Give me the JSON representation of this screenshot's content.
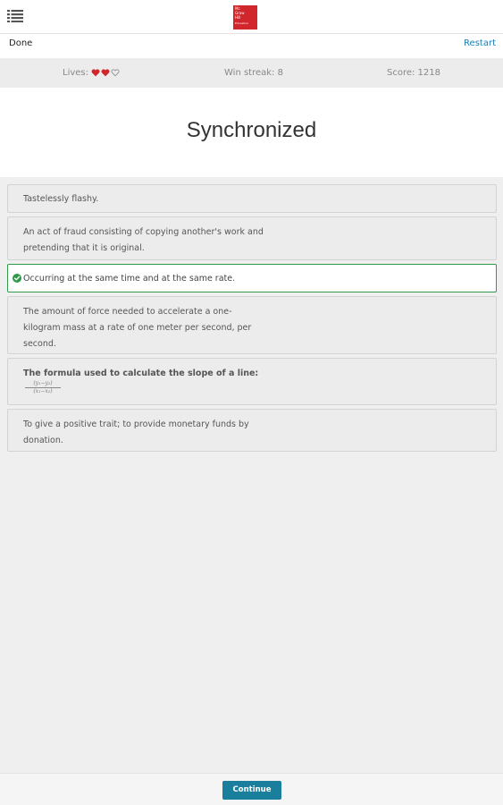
{
  "header": {
    "menu_icon": "hamburger-list-icon",
    "logo_lines": [
      "Mc",
      "Graw",
      "Hill",
      "Education"
    ]
  },
  "actionbar": {
    "done_label": "Done",
    "restart_label": "Restart"
  },
  "status": {
    "lives_label": "Lives:",
    "lives_total": 3,
    "lives_remaining": 2,
    "win_streak": "Win streak: 8",
    "score": "Score: 1218"
  },
  "question": {
    "term": "Synchronized"
  },
  "answers": [
    {
      "text": "Tastelessly flashy.",
      "state": "default"
    },
    {
      "text": "An act of fraud consisting of copying another's work and pretending that it is original.",
      "state": "default"
    },
    {
      "text": "Occurring at the same time and at the same rate.",
      "state": "correct",
      "icon": "check-circle-icon"
    },
    {
      "text": "The amount of force needed to accelerate a one-kilogram mass at a rate of one meter per second, per second.",
      "state": "default"
    },
    {
      "text": "The formula used to calculate the slope of a line:",
      "state": "default",
      "formula_num": "(y₁−y₂)",
      "formula_den": "(x₁−x₂)"
    },
    {
      "text": "To give a positive trait; to provide monetary funds by donation.",
      "state": "default"
    }
  ],
  "footer": {
    "continue_label": "Continue"
  },
  "colors": {
    "accent": "#1a7f9c",
    "correct": "#2e9a4a",
    "heart": "#d1262b",
    "link": "#1a7fb5"
  }
}
